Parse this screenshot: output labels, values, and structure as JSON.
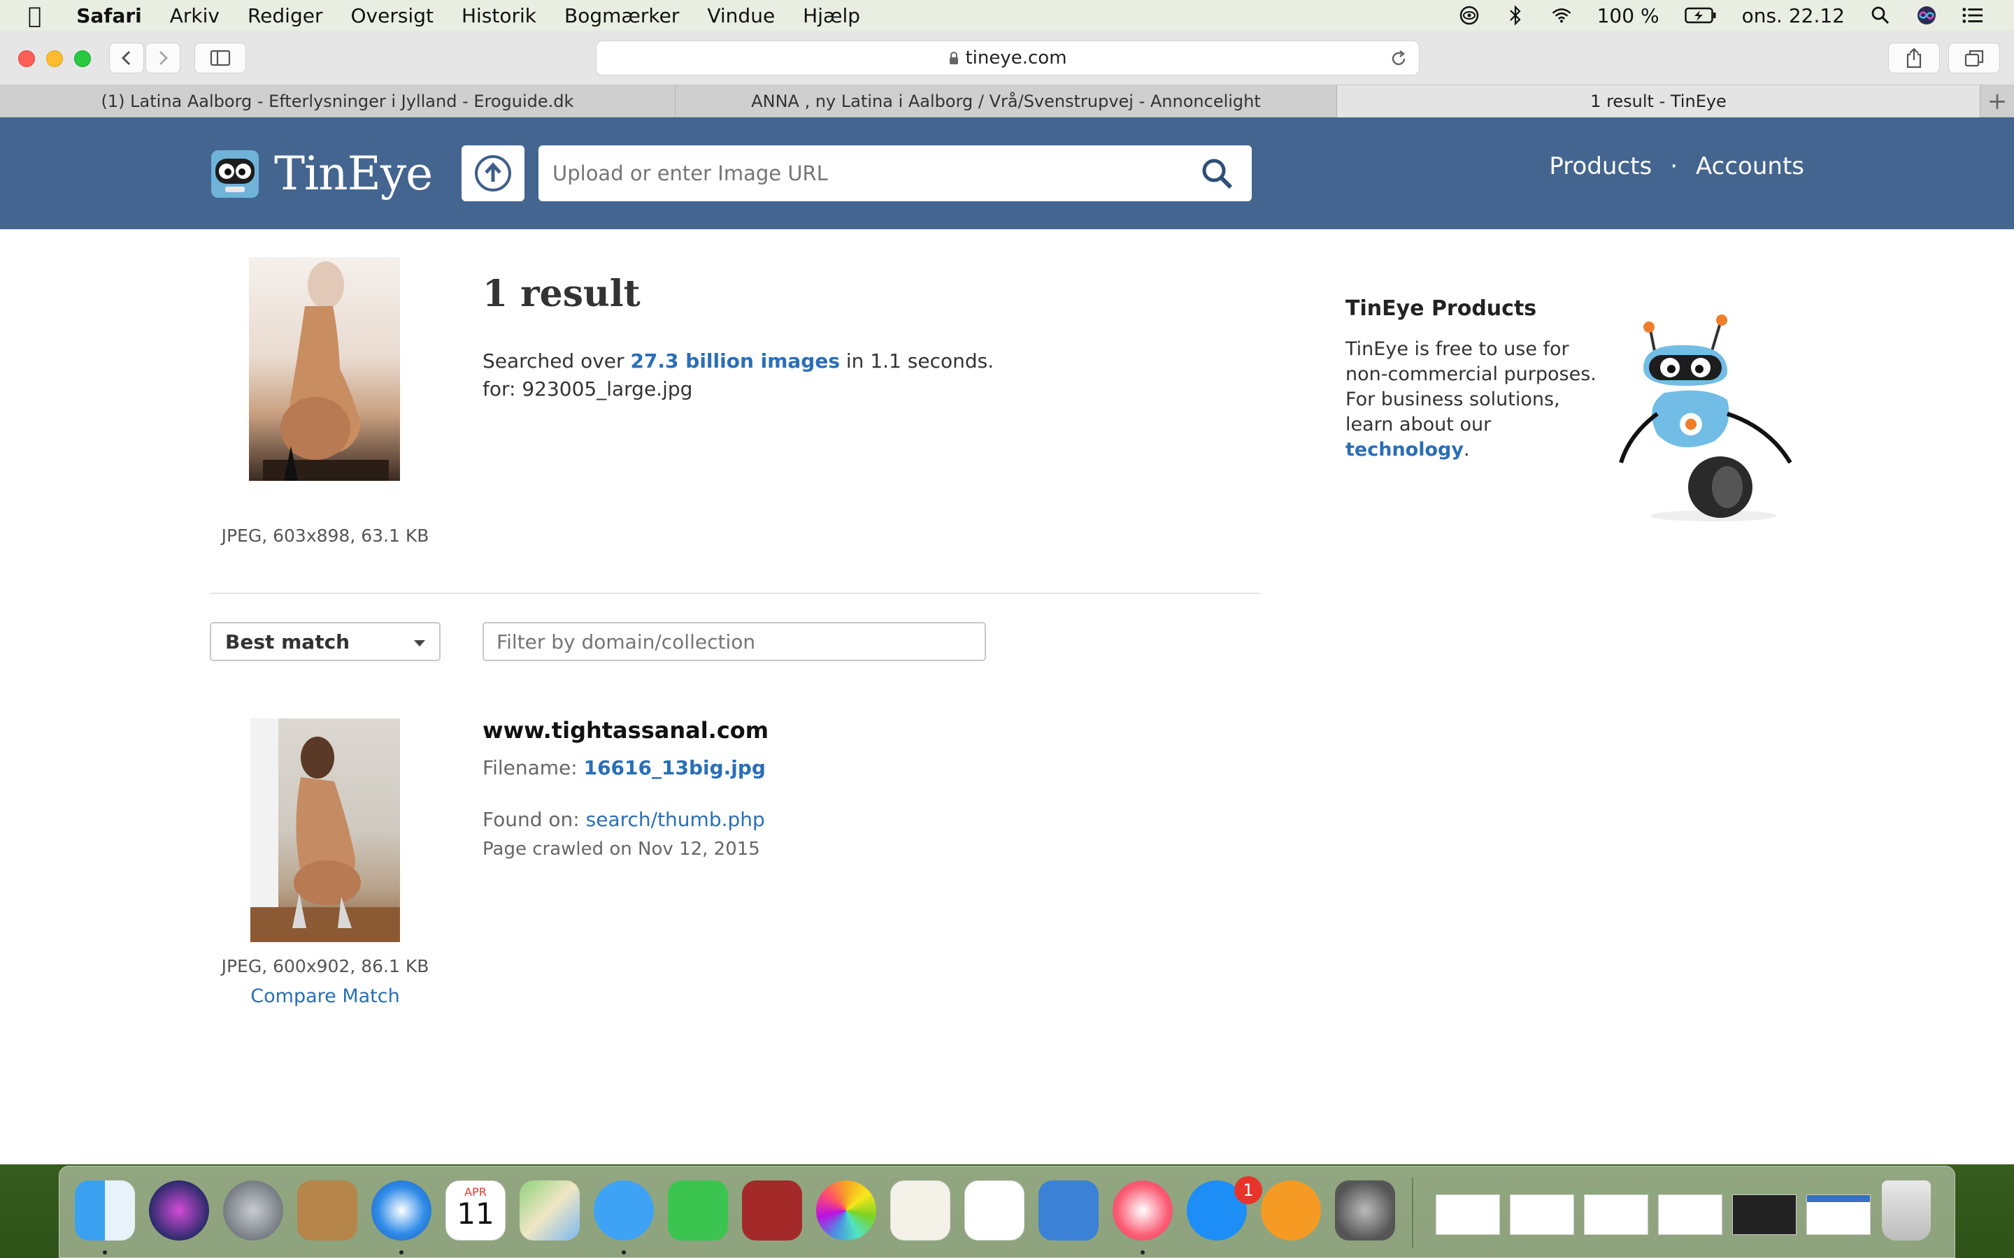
{
  "menubar": {
    "app": "Safari",
    "items": [
      "Arkiv",
      "Rediger",
      "Oversigt",
      "Historik",
      "Bogmærker",
      "Vindue",
      "Hjælp"
    ],
    "battery": "100 %",
    "clock": "ons. 22.12"
  },
  "browser": {
    "url": "tineye.com",
    "tabs": [
      {
        "label": "(1) Latina Aalborg - Efterlysninger i Jylland - Eroguide.dk"
      },
      {
        "label": "ANNA , ny Latina i Aalborg / Vrå/Svenstrupvej - Annoncelight"
      },
      {
        "label": "1 result - TinEye"
      }
    ],
    "new_tab": "+"
  },
  "header": {
    "logo": "TinEye",
    "search_placeholder": "Upload or enter Image URL",
    "nav_products": "Products",
    "nav_sep": "·",
    "nav_accounts": "Accounts"
  },
  "query": {
    "meta": "JPEG, 603x898, 63.1 KB",
    "result_count": "1 result",
    "searched_prefix": "Searched over ",
    "searched_link": "27.3 billion images",
    "searched_suffix": " in 1.1 seconds.",
    "for_line": "for: 923005_large.jpg"
  },
  "sidebar": {
    "title": "TinEye Products",
    "text": "TinEye is free to use for non-commercial purposes. For business solutions, learn about our ",
    "link": "technology",
    "end": "."
  },
  "controls": {
    "sort_label": "Best match",
    "filter_placeholder": "Filter by domain/collection"
  },
  "result": {
    "domain": "www.tightassanal.com",
    "filename_label": "Filename: ",
    "filename": "16616_13big.jpg",
    "found_label": "Found on: ",
    "found_link": "search/thumb.php",
    "crawled": "Page crawled on Nov 12, 2015",
    "meta": "JPEG, 600x902, 86.1 KB",
    "compare": "Compare Match"
  },
  "dock": {
    "calendar_month": "APR",
    "calendar_day": "11",
    "appstore_badge": "1"
  }
}
